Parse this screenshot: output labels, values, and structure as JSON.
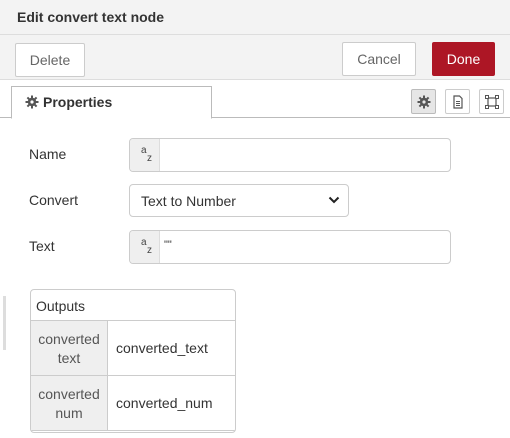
{
  "dialog": {
    "title": "Edit convert text node"
  },
  "toolbar": {
    "delete_label": "Delete",
    "cancel_label": "Cancel",
    "done_label": "Done"
  },
  "tabs": {
    "properties_label": "Properties"
  },
  "form": {
    "name_label": "Name",
    "name_value": "",
    "convert_label": "Convert",
    "convert_value": "Text to Number",
    "text_label": "Text",
    "text_value": "\"\"",
    "type_glyph_a": "a",
    "type_glyph_z": "z"
  },
  "outputs": {
    "title": "Outputs",
    "rows": [
      {
        "key_line1": "converted",
        "key_line2": "text",
        "value": "converted_text"
      },
      {
        "key_line1": "converted",
        "key_line2": "num",
        "value": "converted_num"
      }
    ]
  },
  "icons": {
    "tab_icon": "gear-icon",
    "side_buttons": [
      "gear-icon",
      "document-icon",
      "frame-icon"
    ]
  },
  "colors": {
    "done_bg": "#ad1625",
    "header_bg": "#f3f3f3"
  }
}
